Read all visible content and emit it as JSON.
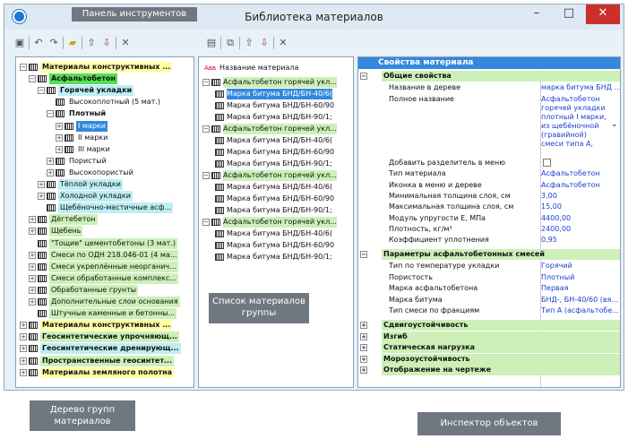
{
  "window": {
    "title": "Библиотека материалов"
  },
  "annotations": {
    "toolbar": "Панель инструментов",
    "group_list": "Список материалов группы",
    "tree": "Дерево групп материалов",
    "inspector": "Инспектор объектов"
  },
  "tree": {
    "items": [
      {
        "t": "Материалы конструктивных ...",
        "bold": true,
        "lvl": 0,
        "pm": "−",
        "cls": "yl"
      },
      {
        "t": "Асфальтобетон",
        "bold": true,
        "lvl": 1,
        "pm": "−",
        "cls": "gB"
      },
      {
        "t": "Горячей укладки",
        "bold": true,
        "lvl": 2,
        "pm": "−",
        "cls": "cy"
      },
      {
        "t": "Высокоплотный (5 мат.)",
        "lvl": 3,
        "pm": "",
        "cls": ""
      },
      {
        "t": "Плотный",
        "bold": true,
        "lvl": 3,
        "pm": "−",
        "cls": ""
      },
      {
        "t": "I марки",
        "lvl": 4,
        "pm": "+",
        "cls": "sel"
      },
      {
        "t": "II марки",
        "lvl": 4,
        "pm": "+",
        "cls": ""
      },
      {
        "t": "III марки",
        "lvl": 4,
        "pm": "+",
        "cls": ""
      },
      {
        "t": "Пористый",
        "lvl": 3,
        "pm": "+",
        "cls": ""
      },
      {
        "t": "Высокопористый",
        "lvl": 3,
        "pm": "+",
        "cls": ""
      },
      {
        "t": "Тёплой укладки",
        "lvl": 2,
        "pm": "+",
        "cls": "cy"
      },
      {
        "t": "Холодной укладки",
        "lvl": 2,
        "pm": "+",
        "cls": "cy"
      },
      {
        "t": "Щебёночно-мастичные асф...",
        "lvl": 2,
        "pm": "",
        "cls": "cy"
      },
      {
        "t": "Дёгтебетон",
        "lvl": 1,
        "pm": "+",
        "cls": "g"
      },
      {
        "t": "Щебень",
        "lvl": 1,
        "pm": "+",
        "cls": "g"
      },
      {
        "t": "\"Тощие\" цементобетоны (3 мат.)",
        "lvl": 1,
        "pm": "",
        "cls": "g"
      },
      {
        "t": "Смеси по ОДН 218.046-01 (4 ма...",
        "lvl": 1,
        "pm": "+",
        "cls": "g"
      },
      {
        "t": "Смеси укреплённые неорганич...",
        "lvl": 1,
        "pm": "+",
        "cls": "g"
      },
      {
        "t": "Смеси обработанные комплекс...",
        "lvl": 1,
        "pm": "+",
        "cls": "g"
      },
      {
        "t": "Обработанные грунты",
        "lvl": 1,
        "pm": "+",
        "cls": "g"
      },
      {
        "t": "Дополнительные слои основания",
        "lvl": 1,
        "pm": "+",
        "cls": "g"
      },
      {
        "t": "Штучные каменные и бетонны...",
        "lvl": 1,
        "pm": "",
        "cls": "g"
      },
      {
        "t": "Материалы конструктивных ...",
        "bold": true,
        "lvl": 0,
        "pm": "+",
        "cls": "yl"
      },
      {
        "t": "Геосинтетические упрочняющ...",
        "bold": true,
        "lvl": 0,
        "pm": "+",
        "cls": "g"
      },
      {
        "t": "Геосинтетические дренирующ...",
        "bold": true,
        "lvl": 0,
        "pm": "+",
        "cls": "cy"
      },
      {
        "t": "Пространственные геосинтет...",
        "bold": true,
        "lvl": 0,
        "pm": "+",
        "cls": "g"
      },
      {
        "t": "Материалы земляного полотна",
        "bold": true,
        "lvl": 0,
        "pm": "+",
        "cls": "yl"
      }
    ]
  },
  "group_list": {
    "header": "Название материала",
    "items": [
      {
        "t": "Асфальтобетон горячей укл...",
        "grp": true
      },
      {
        "t": "Марка битума БНД/БН-40/6(",
        "sel": true
      },
      {
        "t": "Марка битума БНД/БН-60/90"
      },
      {
        "t": "Марка битума БНД/БН-90/1;"
      },
      {
        "t": "Асфальтобетон горячей укл...",
        "grp": true
      },
      {
        "t": "Марка битума БНД/БН-40/6("
      },
      {
        "t": "Марка битума БНД/БН-60/90"
      },
      {
        "t": "Марка битума БНД/БН-90/1;"
      },
      {
        "t": "Асфальтобетон горячей укл...",
        "grp": true
      },
      {
        "t": "Марка битума БНД/БН-40/6("
      },
      {
        "t": "Марка битума БНД/БН-60/90"
      },
      {
        "t": "Марка битума БНД/БН-90/1;"
      },
      {
        "t": "Асфальтобетон горячей укл...",
        "grp": true
      },
      {
        "t": "Марка битума БНД/БН-40/6("
      },
      {
        "t": "Марка битума БНД/БН-60/90"
      },
      {
        "t": "Марка битума БНД/БН-90/1;"
      }
    ]
  },
  "inspector": {
    "header": "Свойства материала",
    "general": "Общие свойства",
    "name_in_tree": {
      "n": "Название в дереве",
      "v": "марка битума БНД ..."
    },
    "full_name": {
      "n": "Полное название",
      "v": [
        "Асфальтобетон",
        "горячей укладки",
        "плотный I марки,",
        "из щебёночной",
        "(гравийной)",
        "смеси типа А,"
      ]
    },
    "props": [
      {
        "n": "Добавить разделитель в меню",
        "v": ""
      },
      {
        "n": "Тип материала",
        "v": "Асфальтобетон"
      },
      {
        "n": "Иконка в меню и дереве",
        "v": "Асфальтобетон"
      },
      {
        "n": "Минимальная толщина слоя, см",
        "v": "3,00"
      },
      {
        "n": "Максимальная толщина слоя, см",
        "v": "15,00"
      },
      {
        "n": "Модуль упругости Е, МПа",
        "v": "4400,00"
      },
      {
        "n": "Плотность, кг/м³",
        "v": "2400,00"
      },
      {
        "n": "Коэффициент уплотнения",
        "v": "0,95"
      }
    ],
    "asph_header": "Параметры асфальтобетонных смесей",
    "asph": [
      {
        "n": "Тип по температуре укладки",
        "v": "Горячий"
      },
      {
        "n": "Пористость",
        "v": "Плотный"
      },
      {
        "n": "Марка асфальтобетона",
        "v": "Первая"
      },
      {
        "n": "Марка битума",
        "v": "БНД-, БН-40/60 (вя..."
      },
      {
        "n": "Тип смеси по фракциям",
        "v": "Тип А (асфальтобе..."
      }
    ],
    "sections": [
      "Сдвигоустойчивость",
      "Изгиб",
      "Статическая нагрузка",
      "Морозоустойчивость",
      "Отображение на чертеже"
    ]
  }
}
